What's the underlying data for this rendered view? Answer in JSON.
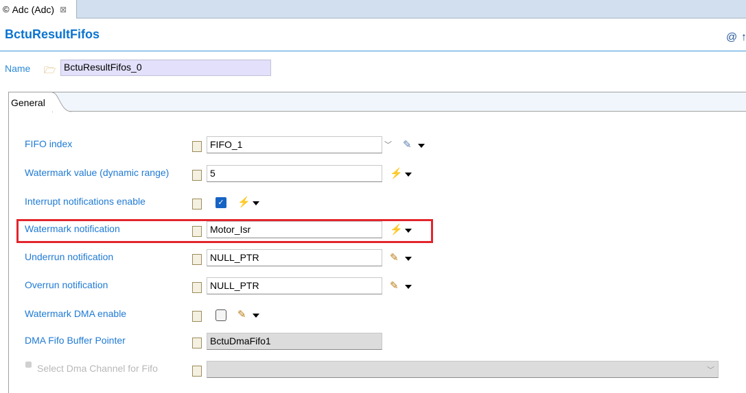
{
  "editor_tab": {
    "label": "Adc (Adc)",
    "close": "⊠"
  },
  "title": "BctuResultFifos",
  "header_icons": [
    "@",
    "↑"
  ],
  "name": {
    "label": "Name",
    "value": "BctuResultFifos_0"
  },
  "group_tab": "General",
  "rows": [
    {
      "label": "FIFO index",
      "value": "FIFO_1",
      "icon": "C",
      "type": "combo"
    },
    {
      "label": "Watermark value (dynamic range)",
      "value": "5",
      "icon": "12",
      "type": "text"
    },
    {
      "label": "Interrupt notifications enable",
      "checked": true,
      "icon": "X",
      "type": "checkbox"
    },
    {
      "label": "Watermark notification",
      "value": "Motor_Isr",
      "icon": "",
      "type": "text",
      "highlighted": true
    },
    {
      "label": "Underrun notification",
      "value": "NULL_PTR",
      "icon": "D",
      "type": "text"
    },
    {
      "label": "Overrun notification",
      "value": "NULL_PTR",
      "icon": "D",
      "type": "text"
    },
    {
      "label": "Watermark DMA enable",
      "checked": false,
      "icon": "D",
      "type": "checkbox"
    },
    {
      "label": "DMA Fifo Buffer Pointer",
      "value": "BctuDmaFifo1",
      "icon": "C",
      "type": "readonly"
    },
    {
      "label": "Select Dma Channel for Fifo",
      "value": "",
      "icon": "@",
      "type": "disabled-combo"
    }
  ],
  "colors": {
    "accent": "#0a74d0",
    "highlight": "#e3242b"
  }
}
